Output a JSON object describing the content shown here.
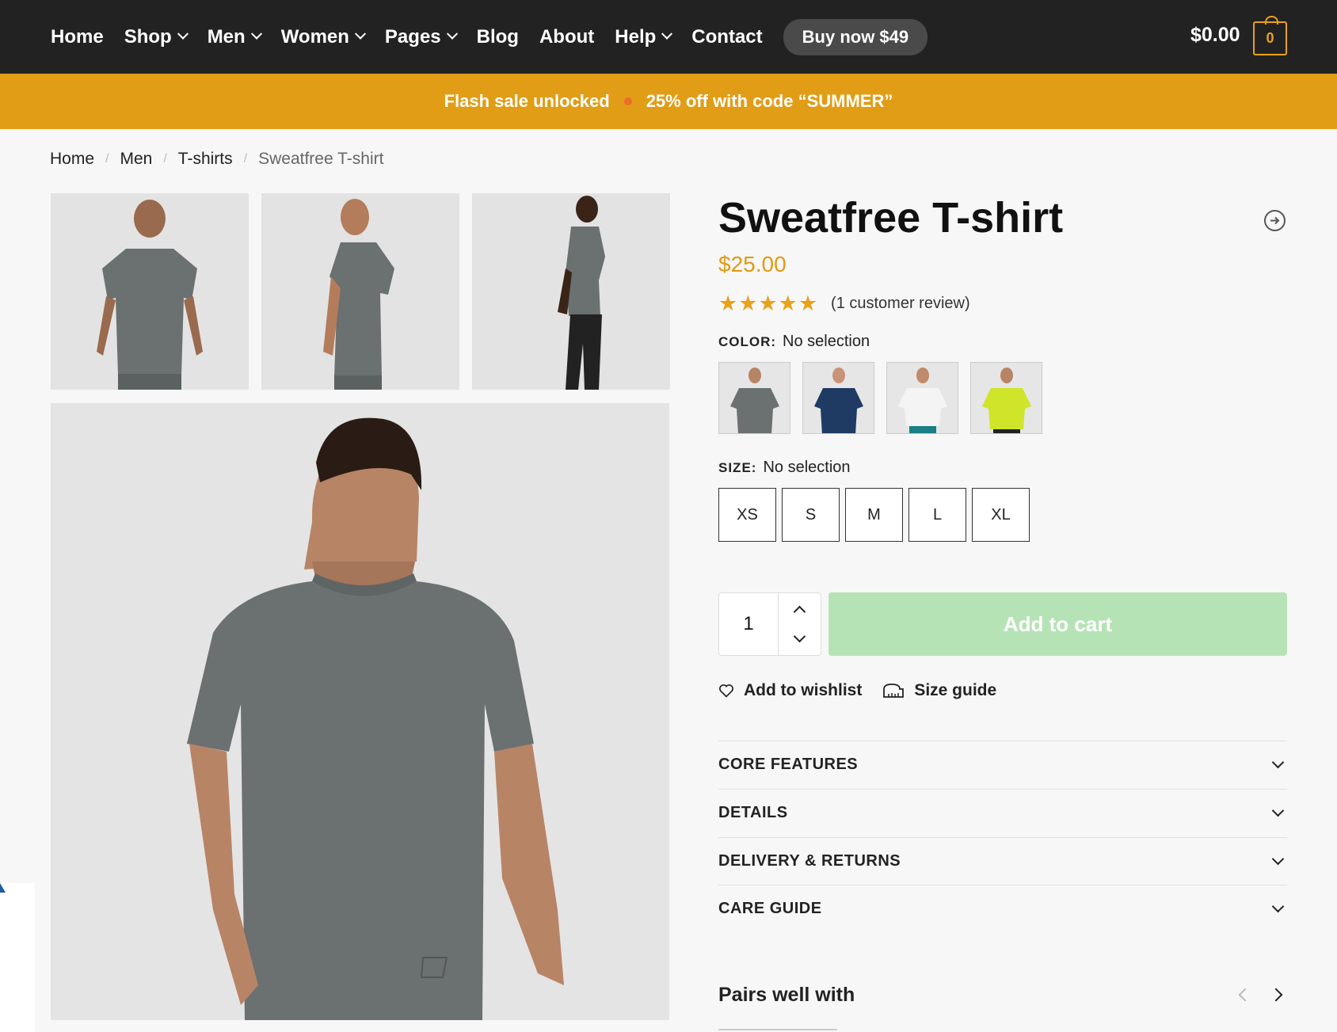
{
  "nav": {
    "items": [
      {
        "label": "Home",
        "dropdown": false
      },
      {
        "label": "Shop",
        "dropdown": true
      },
      {
        "label": "Men",
        "dropdown": true
      },
      {
        "label": "Women",
        "dropdown": true
      },
      {
        "label": "Pages",
        "dropdown": true
      },
      {
        "label": "Blog",
        "dropdown": false
      },
      {
        "label": "About",
        "dropdown": false
      },
      {
        "label": "Help",
        "dropdown": true
      },
      {
        "label": "Contact",
        "dropdown": false
      }
    ],
    "buy_now": "Buy now $49",
    "cart_total": "$0.00",
    "cart_count": "0"
  },
  "promo": {
    "left": "Flash sale unlocked",
    "right": "25% off with code “SUMMER”"
  },
  "breadcrumb": [
    "Home",
    "Men",
    "T-shirts",
    "Sweatfree T-shirt"
  ],
  "product": {
    "title": "Sweatfree T-shirt",
    "price": "$25.00",
    "stars": "★★★★★",
    "rating": 5,
    "review_text": "(1 customer review)",
    "color_label": "COLOR:",
    "color_value": "No selection",
    "color_swatches": [
      {
        "name": "grey",
        "shirt": "#6b7070"
      },
      {
        "name": "navy",
        "shirt": "#1f3b63"
      },
      {
        "name": "white",
        "shirt": "#f4f4f4"
      },
      {
        "name": "lime",
        "shirt": "#cfe52a"
      }
    ],
    "size_label": "SIZE:",
    "size_value": "No selection",
    "sizes": [
      "XS",
      "S",
      "M",
      "L",
      "XL"
    ],
    "quantity": "1",
    "add_to_cart": "Add to cart",
    "wishlist": "Add to wishlist",
    "size_guide": "Size guide",
    "accordions": [
      "CORE FEATURES",
      "DETAILS",
      "DELIVERY & RETURNS",
      "CARE GUIDE"
    ],
    "pairs_title": "Pairs well with"
  },
  "colors": {
    "nav_bg": "#222222",
    "promo_bg": "#e19d16",
    "accent": "#e09a12",
    "cart_button": "#b6e3b6",
    "shirt_grey": "#6b7070"
  }
}
